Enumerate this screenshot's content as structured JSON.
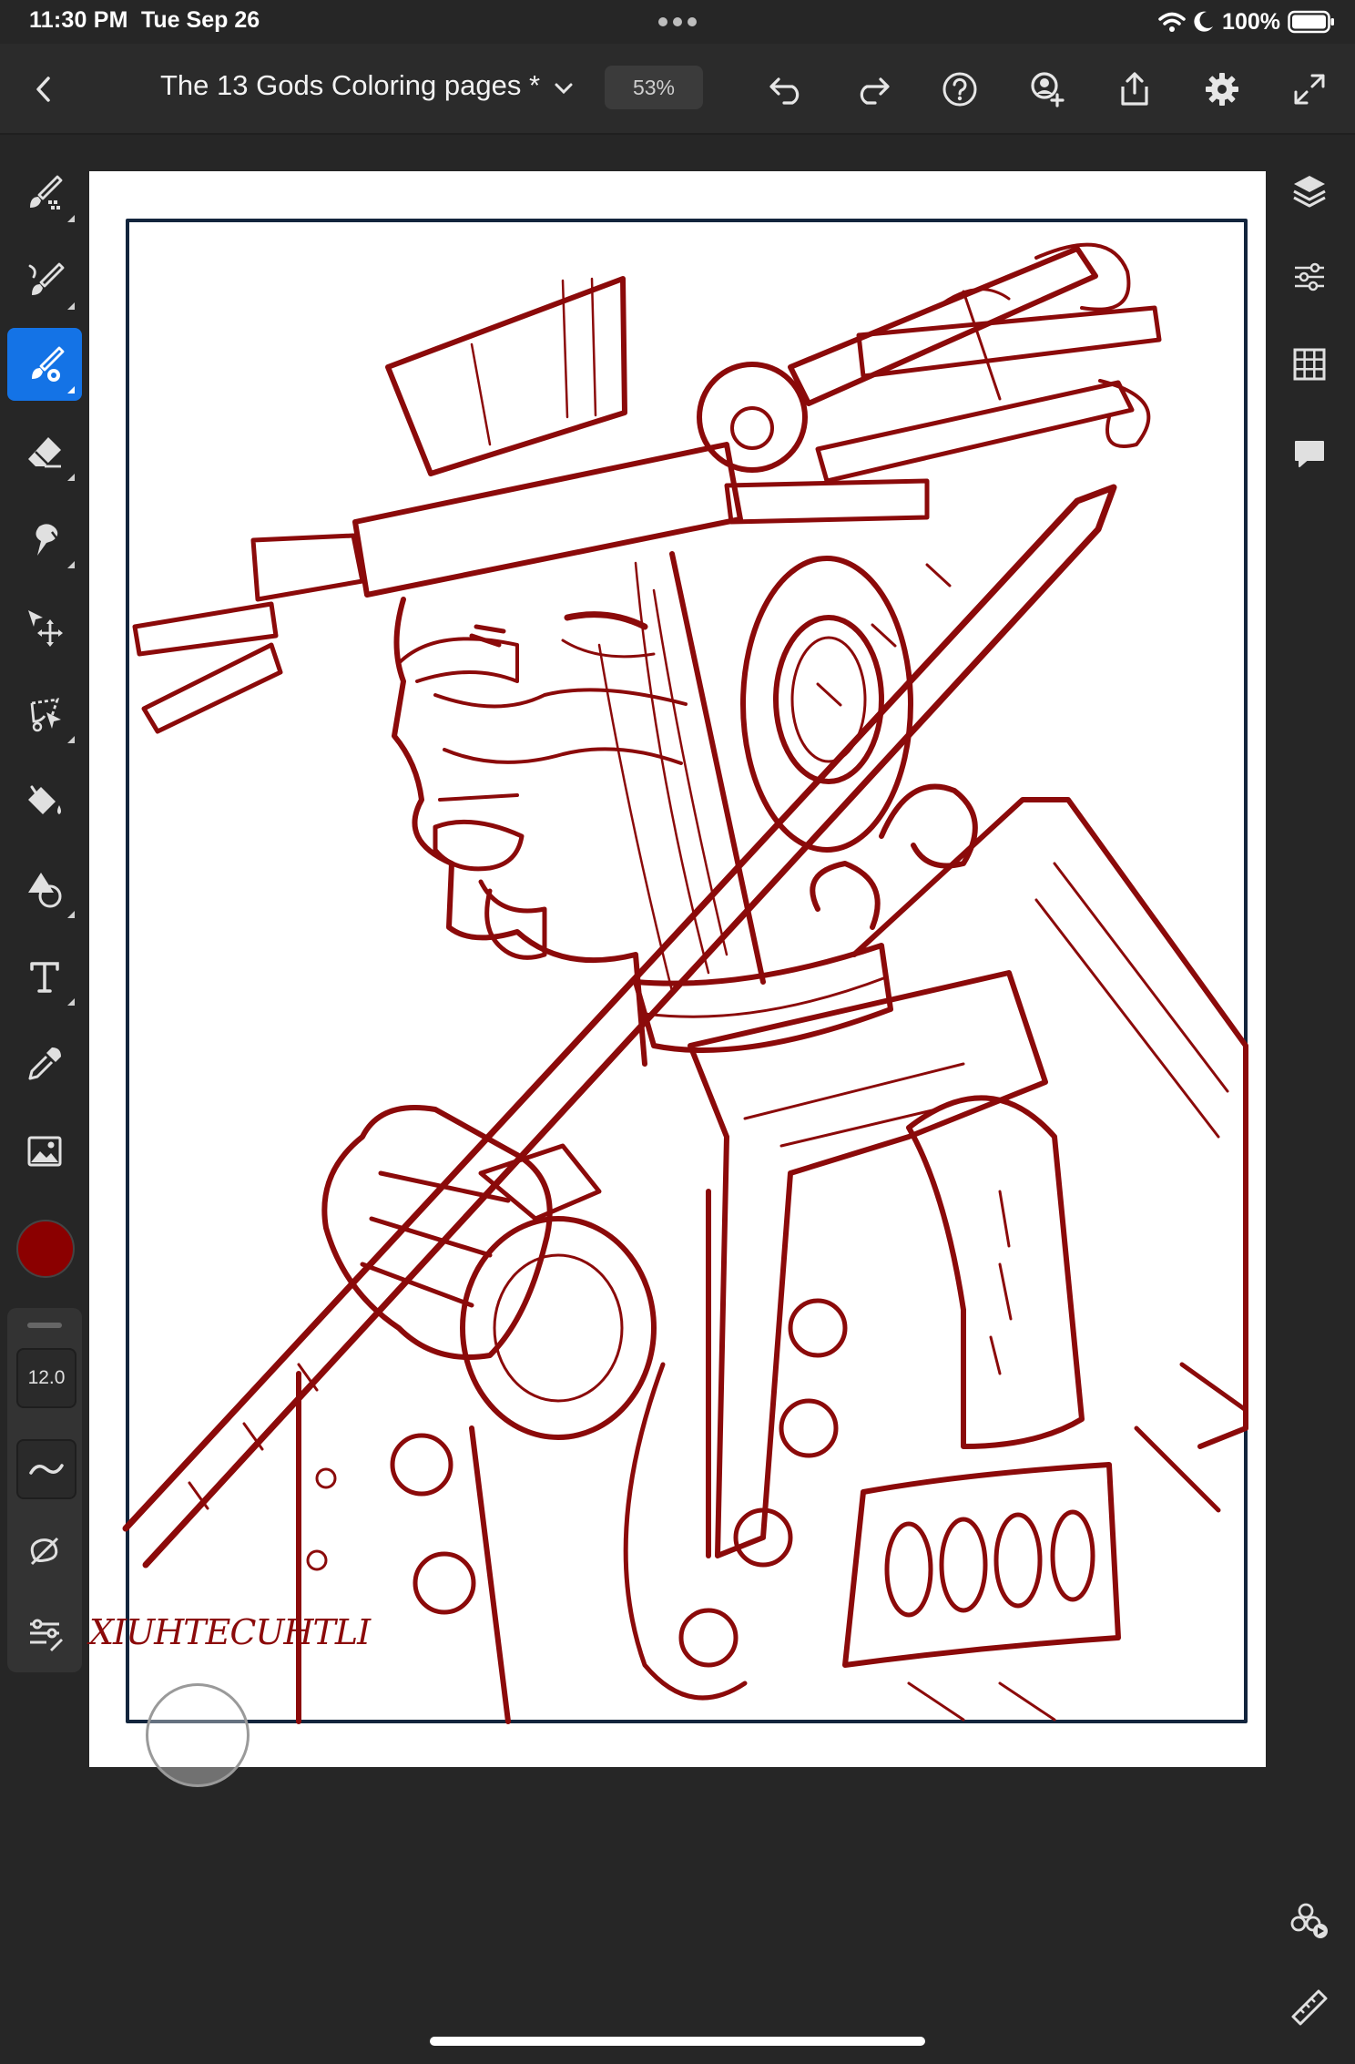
{
  "status_bar": {
    "time": "11:30 PM",
    "date": "Tue Sep 26",
    "battery_percent": "100%",
    "icons": [
      "wifi-icon",
      "moon-icon",
      "battery-icon"
    ]
  },
  "toolbar": {
    "document_title": "The 13 Gods Coloring pages *",
    "zoom": "53%",
    "icons": [
      "back-chevron-icon",
      "title-dropdown-icon",
      "undo-icon",
      "redo-icon",
      "help-icon",
      "invite-user-icon",
      "share-icon",
      "settings-gear-icon",
      "fullscreen-icon"
    ]
  },
  "left_tools": {
    "items": [
      "brush-tool-icon",
      "paint-brush-tool-icon",
      "mixer-brush-tool-icon",
      "eraser-tool-icon",
      "smudge-tool-icon",
      "move-tool-icon",
      "lasso-select-icon",
      "paint-bucket-icon",
      "shape-tool-icon",
      "type-tool-icon",
      "eyedropper-icon",
      "place-image-icon"
    ],
    "active_index": 2,
    "current_color": "#8b0000",
    "brush_size": "12.0",
    "panel_icons": [
      "smoothing-icon",
      "predictive-stroke-icon",
      "brush-settings-icon"
    ]
  },
  "right_tools": {
    "items": [
      "layers-icon",
      "adjustments-icon",
      "grid-icon",
      "comment-icon",
      "cloud-share-icon",
      "ruler-icon"
    ]
  },
  "canvas": {
    "artwork_alt": "Line-art coloring page of an Aztec god with headdress, staff and ornaments",
    "signature_text": "XIUHTECUHTLI",
    "line_color": "#8b0a0a",
    "frame_color": "#13253d"
  }
}
